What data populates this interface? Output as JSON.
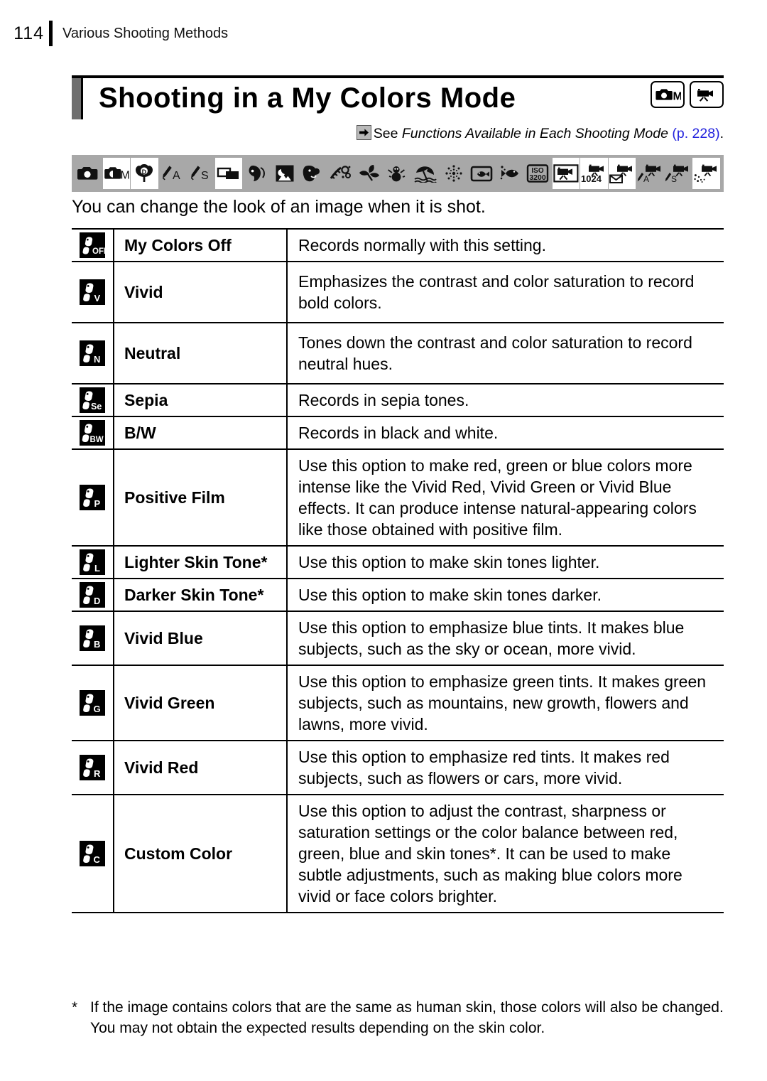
{
  "header": {
    "page_number": "114",
    "running_head": "Various Shooting Methods"
  },
  "title": {
    "text": "Shooting in a My Colors Mode",
    "badges": [
      {
        "name": "camera-manual-mode-badge",
        "label": "M"
      },
      {
        "name": "movie-mode-badge",
        "label": ""
      }
    ]
  },
  "xref": {
    "arrow_icon": "right-arrow-icon",
    "see_label": "See ",
    "reference_title": "Functions Available in Each Shooting Mode",
    "page_ref": " (p. 228)",
    "period": ".",
    "link_color": "#2222dd"
  },
  "mode_strip": {
    "background": "#a8a8a8",
    "icons": [
      {
        "name": "auto-mode-icon",
        "glyph": "camera",
        "highlighted": false
      },
      {
        "name": "manual-mode-icon",
        "glyph": "camera-m",
        "highlighted": true
      },
      {
        "name": "digital-macro-mode-icon",
        "glyph": "digital-macro",
        "highlighted": true
      },
      {
        "name": "color-accent-mode-icon",
        "glyph": "brush-a",
        "highlighted": false
      },
      {
        "name": "color-swap-mode-icon",
        "glyph": "brush-s",
        "highlighted": false
      },
      {
        "name": "stitch-assist-mode-icon",
        "glyph": "stitch",
        "highlighted": true
      },
      {
        "name": "portrait-mode-icon",
        "glyph": "portrait",
        "highlighted": false
      },
      {
        "name": "night-snapshot-mode-icon",
        "glyph": "night",
        "highlighted": false
      },
      {
        "name": "kids-and-pets-mode-icon",
        "glyph": "kids",
        "highlighted": false
      },
      {
        "name": "indoor-mode-icon",
        "glyph": "indoor",
        "highlighted": false
      },
      {
        "name": "foliage-mode-icon",
        "glyph": "foliage",
        "highlighted": false
      },
      {
        "name": "snow-mode-icon",
        "glyph": "snow",
        "highlighted": false
      },
      {
        "name": "beach-mode-icon",
        "glyph": "beach",
        "highlighted": false
      },
      {
        "name": "fireworks-mode-icon",
        "glyph": "fireworks",
        "highlighted": false
      },
      {
        "name": "aquarium-mode-icon",
        "glyph": "aquarium",
        "highlighted": false
      },
      {
        "name": "underwater-mode-icon",
        "glyph": "underwater",
        "highlighted": false
      },
      {
        "name": "iso-3200-mode-icon",
        "glyph": "iso3200",
        "highlighted": false
      },
      {
        "name": "movie-standard-mode-icon",
        "glyph": "movie",
        "highlighted": true
      },
      {
        "name": "movie-1024-mode-icon",
        "glyph": "movie-1024",
        "highlighted": true
      },
      {
        "name": "movie-compact-mode-icon",
        "glyph": "movie-mail",
        "highlighted": true
      },
      {
        "name": "movie-color-accent-mode-icon",
        "glyph": "movie-brush-a",
        "highlighted": false
      },
      {
        "name": "movie-color-swap-mode-icon",
        "glyph": "movie-brush-s",
        "highlighted": false
      },
      {
        "name": "movie-timelapse-mode-icon",
        "glyph": "movie-timelapse",
        "highlighted": true
      }
    ],
    "iso_label": "ISO",
    "iso_value": "3200",
    "movie_1024_label": "1024"
  },
  "intro": "You can change the look of an image when it is shot.",
  "table": {
    "rows": [
      {
        "icon_name": "my-colors-off-icon",
        "icon_sub": "OFF",
        "name": "My Colors Off",
        "desc": "Records normally with this setting."
      },
      {
        "icon_name": "my-colors-vivid-icon",
        "icon_sub": "V",
        "name": "Vivid",
        "desc": "Emphasizes the contrast and color saturation to record bold colors."
      },
      {
        "icon_name": "my-colors-neutral-icon",
        "icon_sub": "N",
        "name": "Neutral",
        "desc": "Tones down the contrast and color saturation to record neutral hues."
      },
      {
        "icon_name": "my-colors-sepia-icon",
        "icon_sub": "Se",
        "name": "Sepia",
        "desc": "Records in sepia tones."
      },
      {
        "icon_name": "my-colors-bw-icon",
        "icon_sub": "BW",
        "name": "B/W",
        "desc": "Records in black and white."
      },
      {
        "icon_name": "my-colors-positive-film-icon",
        "icon_sub": "P",
        "name": "Positive Film",
        "desc": "Use this option to make red, green or blue colors more intense like the Vivid Red, Vivid Green or Vivid Blue effects. It can produce intense natural-appearing colors like those obtained with positive film."
      },
      {
        "icon_name": "my-colors-lighter-skin-tone-icon",
        "icon_sub": "L",
        "name": "Lighter Skin Tone*",
        "desc": "Use this option to make skin tones lighter."
      },
      {
        "icon_name": "my-colors-darker-skin-tone-icon",
        "icon_sub": "D",
        "name": "Darker Skin Tone*",
        "desc": "Use this option to make skin tones darker."
      },
      {
        "icon_name": "my-colors-vivid-blue-icon",
        "icon_sub": "B",
        "name": "Vivid Blue",
        "desc": "Use this option to emphasize blue tints. It makes blue subjects, such as the sky or ocean, more vivid."
      },
      {
        "icon_name": "my-colors-vivid-green-icon",
        "icon_sub": "G",
        "name": "Vivid Green",
        "desc": "Use this option to emphasize green tints. It makes green subjects, such as mountains, new growth, flowers and lawns, more vivid."
      },
      {
        "icon_name": "my-colors-vivid-red-icon",
        "icon_sub": "R",
        "name": "Vivid Red",
        "desc": "Use this option to emphasize red tints. It makes red subjects, such as flowers or cars, more vivid."
      },
      {
        "icon_name": "my-colors-custom-color-icon",
        "icon_sub": "C",
        "name": "Custom Color",
        "desc": "Use this option to adjust the contrast, sharpness or saturation settings or the color balance between red, green, blue and skin tones*. It can be used to make subtle adjustments, such as making blue colors more vivid or face colors brighter."
      }
    ]
  },
  "footnote": {
    "marker": "*",
    "text": "If the image contains colors that are the same as human skin, those colors will also be changed. You may not obtain the expected results depending on the skin color."
  }
}
